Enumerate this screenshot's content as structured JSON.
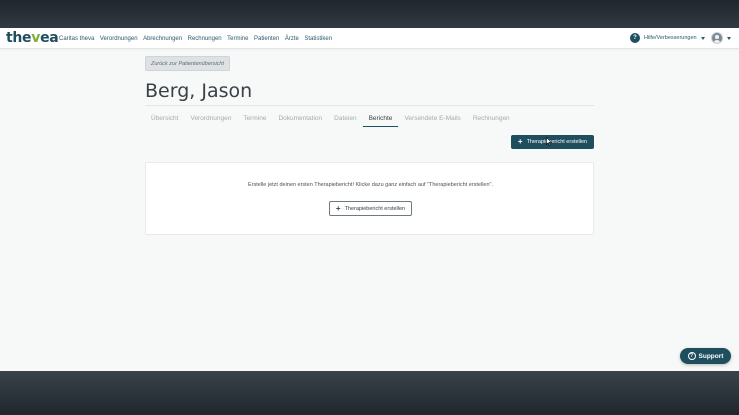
{
  "navbar": {
    "logo": {
      "main": "the",
      "accent": "v",
      "rest": "ea"
    },
    "links": [
      "Caritas theva",
      "Verordnungen",
      "Abrechnungen",
      "Rechnungen",
      "Termine",
      "Patienten",
      "Ärzte",
      "Statistiken"
    ],
    "help_icon": "?",
    "help_label": "Hilfe/Verbesserungen"
  },
  "back_button": "Zurück zur Patientenübersicht",
  "patient_name": "Berg, Jason",
  "tabs": [
    {
      "label": "Übersicht",
      "active": false
    },
    {
      "label": "Verordnungen",
      "active": false
    },
    {
      "label": "Termine",
      "active": false
    },
    {
      "label": "Dokumentation",
      "active": false
    },
    {
      "label": "Dateien",
      "active": false
    },
    {
      "label": "Berichte",
      "active": true
    },
    {
      "label": "Versendete E-Mails",
      "active": false
    },
    {
      "label": "Rechnungen",
      "active": false
    }
  ],
  "primary_button": {
    "icon": "+",
    "label": "Therapiebericht erstellen"
  },
  "empty_state": {
    "text": "Erstelle jetzt deinen ersten Therapiebericht! Klicke dazu ganz einfach auf \"Therapiebericht erstellen\".",
    "button_icon": "+",
    "button_label": "Therapiebericht erstellen"
  },
  "support": {
    "icon": "?",
    "label": "Support"
  },
  "colors": {
    "primary": "#1f4e5f",
    "logo_accent": "#7fb03a",
    "background": "#f7f8f8",
    "frame": "#2a3138"
  }
}
